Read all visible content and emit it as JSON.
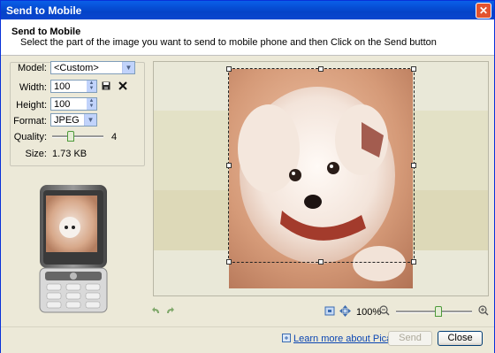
{
  "window": {
    "title": "Send to Mobile",
    "close_glyph": "✕"
  },
  "header": {
    "title": "Send to Mobile",
    "subtitle": "Select the part of the image you want to send to mobile phone and then Click on the Send button"
  },
  "settings": {
    "model_label": "Model:",
    "model_value": "<Custom>",
    "width_label": "Width:",
    "width_value": "100",
    "height_label": "Height:",
    "height_value": "100",
    "format_label": "Format:",
    "format_value": "JPEG",
    "quality_label": "Quality:",
    "quality_value": "4",
    "quality_level_fraction": 0.35,
    "size_label": "Size:",
    "size_value": "1.73 KB"
  },
  "viewer": {
    "zoom_label": "100%",
    "zoom_level_fraction": 0.55
  },
  "footer": {
    "learn_more": "Learn more about PicaJet FX...",
    "send_label": "Send",
    "close_label": "Close"
  },
  "colors": {
    "titlebar": "#0a5fe8",
    "accent": "#0b46b3",
    "dialog_bg": "#ece9d8"
  },
  "icons": [
    "save-icon",
    "delete-icon",
    "rotate-left-icon",
    "rotate-right-icon",
    "fit-icon",
    "actual-size-icon",
    "zoom-out-icon",
    "zoom-in-icon",
    "info-icon"
  ]
}
